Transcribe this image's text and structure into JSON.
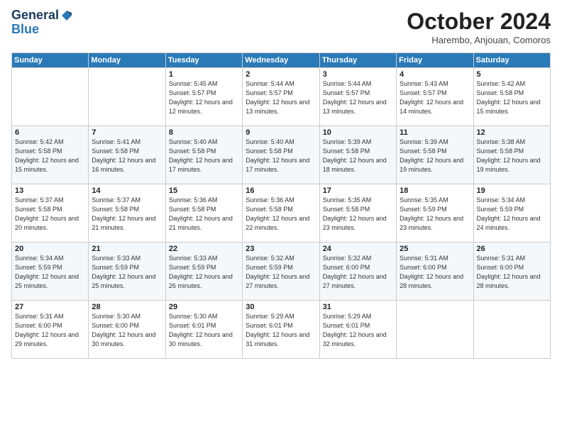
{
  "logo": {
    "line1": "General",
    "line2": "Blue"
  },
  "header": {
    "title": "October 2024",
    "subtitle": "Harembo, Anjouan, Comoros"
  },
  "weekdays": [
    "Sunday",
    "Monday",
    "Tuesday",
    "Wednesday",
    "Thursday",
    "Friday",
    "Saturday"
  ],
  "weeks": [
    [
      null,
      null,
      {
        "day": 1,
        "sunrise": "5:45 AM",
        "sunset": "5:57 PM",
        "daylight": "12 hours and 12 minutes."
      },
      {
        "day": 2,
        "sunrise": "5:44 AM",
        "sunset": "5:57 PM",
        "daylight": "12 hours and 13 minutes."
      },
      {
        "day": 3,
        "sunrise": "5:44 AM",
        "sunset": "5:57 PM",
        "daylight": "12 hours and 13 minutes."
      },
      {
        "day": 4,
        "sunrise": "5:43 AM",
        "sunset": "5:57 PM",
        "daylight": "12 hours and 14 minutes."
      },
      {
        "day": 5,
        "sunrise": "5:42 AM",
        "sunset": "5:58 PM",
        "daylight": "12 hours and 15 minutes."
      }
    ],
    [
      {
        "day": 6,
        "sunrise": "5:42 AM",
        "sunset": "5:58 PM",
        "daylight": "12 hours and 15 minutes."
      },
      {
        "day": 7,
        "sunrise": "5:41 AM",
        "sunset": "5:58 PM",
        "daylight": "12 hours and 16 minutes."
      },
      {
        "day": 8,
        "sunrise": "5:40 AM",
        "sunset": "5:58 PM",
        "daylight": "12 hours and 17 minutes."
      },
      {
        "day": 9,
        "sunrise": "5:40 AM",
        "sunset": "5:58 PM",
        "daylight": "12 hours and 17 minutes."
      },
      {
        "day": 10,
        "sunrise": "5:39 AM",
        "sunset": "5:58 PM",
        "daylight": "12 hours and 18 minutes."
      },
      {
        "day": 11,
        "sunrise": "5:39 AM",
        "sunset": "5:58 PM",
        "daylight": "12 hours and 19 minutes."
      },
      {
        "day": 12,
        "sunrise": "5:38 AM",
        "sunset": "5:58 PM",
        "daylight": "12 hours and 19 minutes."
      }
    ],
    [
      {
        "day": 13,
        "sunrise": "5:37 AM",
        "sunset": "5:58 PM",
        "daylight": "12 hours and 20 minutes."
      },
      {
        "day": 14,
        "sunrise": "5:37 AM",
        "sunset": "5:58 PM",
        "daylight": "12 hours and 21 minutes."
      },
      {
        "day": 15,
        "sunrise": "5:36 AM",
        "sunset": "5:58 PM",
        "daylight": "12 hours and 21 minutes."
      },
      {
        "day": 16,
        "sunrise": "5:36 AM",
        "sunset": "5:58 PM",
        "daylight": "12 hours and 22 minutes."
      },
      {
        "day": 17,
        "sunrise": "5:35 AM",
        "sunset": "5:58 PM",
        "daylight": "12 hours and 23 minutes."
      },
      {
        "day": 18,
        "sunrise": "5:35 AM",
        "sunset": "5:59 PM",
        "daylight": "12 hours and 23 minutes."
      },
      {
        "day": 19,
        "sunrise": "5:34 AM",
        "sunset": "5:59 PM",
        "daylight": "12 hours and 24 minutes."
      }
    ],
    [
      {
        "day": 20,
        "sunrise": "5:34 AM",
        "sunset": "5:59 PM",
        "daylight": "12 hours and 25 minutes."
      },
      {
        "day": 21,
        "sunrise": "5:33 AM",
        "sunset": "5:59 PM",
        "daylight": "12 hours and 25 minutes."
      },
      {
        "day": 22,
        "sunrise": "5:33 AM",
        "sunset": "5:59 PM",
        "daylight": "12 hours and 26 minutes."
      },
      {
        "day": 23,
        "sunrise": "5:32 AM",
        "sunset": "5:59 PM",
        "daylight": "12 hours and 27 minutes."
      },
      {
        "day": 24,
        "sunrise": "5:32 AM",
        "sunset": "6:00 PM",
        "daylight": "12 hours and 27 minutes."
      },
      {
        "day": 25,
        "sunrise": "5:31 AM",
        "sunset": "6:00 PM",
        "daylight": "12 hours and 28 minutes."
      },
      {
        "day": 26,
        "sunrise": "5:31 AM",
        "sunset": "6:00 PM",
        "daylight": "12 hours and 28 minutes."
      }
    ],
    [
      {
        "day": 27,
        "sunrise": "5:31 AM",
        "sunset": "6:00 PM",
        "daylight": "12 hours and 29 minutes."
      },
      {
        "day": 28,
        "sunrise": "5:30 AM",
        "sunset": "6:00 PM",
        "daylight": "12 hours and 30 minutes."
      },
      {
        "day": 29,
        "sunrise": "5:30 AM",
        "sunset": "6:01 PM",
        "daylight": "12 hours and 30 minutes."
      },
      {
        "day": 30,
        "sunrise": "5:29 AM",
        "sunset": "6:01 PM",
        "daylight": "12 hours and 31 minutes."
      },
      {
        "day": 31,
        "sunrise": "5:29 AM",
        "sunset": "6:01 PM",
        "daylight": "12 hours and 32 minutes."
      },
      null,
      null
    ]
  ]
}
